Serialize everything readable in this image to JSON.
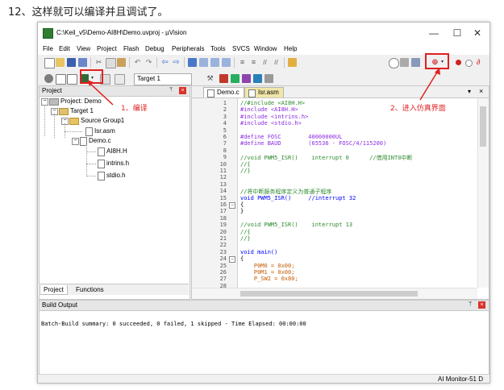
{
  "caption": "12、这样就可以编译并且调试了。",
  "window": {
    "title": "C:\\Keil_v5\\Demo-AI8H\\Demo.uvproj - µVision",
    "minimize": "—",
    "maximize": "☐",
    "close": "✕"
  },
  "menu": [
    "File",
    "Edit",
    "View",
    "Project",
    "Flash",
    "Debug",
    "Peripherals",
    "Tools",
    "SVCS",
    "Window",
    "Help"
  ],
  "toolbar2": {
    "target": "Target 1"
  },
  "project_panel": {
    "title": "Project",
    "pin": "ᛘ",
    "close": "×",
    "root": "Project: Demo",
    "target": "Target 1",
    "group": "Source Group1",
    "files": [
      "Isr.asm",
      "Demo.c"
    ],
    "includes": [
      "AI8H.H",
      "intrins.h",
      "stdio.h"
    ],
    "tabs": [
      "Project",
      "Functions"
    ]
  },
  "editor": {
    "tabs": [
      "Demo.c",
      "Isr.asm"
    ],
    "tabs_menu": "▾",
    "close": "×",
    "lines": [
      {
        "n": "1",
        "t": "//#include <AI8H.H>",
        "c": "cmt"
      },
      {
        "n": "2",
        "t": "#include <AI8H.H>",
        "c": "pp"
      },
      {
        "n": "3",
        "t": "#include <intrins.h>",
        "c": "pp"
      },
      {
        "n": "4",
        "t": "#include <stdio.h>",
        "c": "pp"
      },
      {
        "n": "5",
        "t": "",
        "c": ""
      },
      {
        "n": "6",
        "t": "#define FOSC        40000000UL",
        "c": "pp"
      },
      {
        "n": "7",
        "t": "#define BAUD        (65536 - FOSC/4/115200)",
        "c": "pp"
      },
      {
        "n": "8",
        "t": "",
        "c": ""
      },
      {
        "n": "9",
        "t": "//void PWM5_ISR()    interrupt 0      //借用INT0中断",
        "c": "cmt"
      },
      {
        "n": "10",
        "t": "//{",
        "c": "cmt"
      },
      {
        "n": "11",
        "t": "//}",
        "c": "cmt"
      },
      {
        "n": "12",
        "t": "",
        "c": ""
      },
      {
        "n": "13",
        "t": "",
        "c": ""
      },
      {
        "n": "14",
        "t": "//将中断服务程序定义为普通子程序",
        "c": "cmt"
      },
      {
        "n": "15",
        "t": "void PWM5_ISR()     //interrupt 32",
        "c": "kw"
      },
      {
        "n": "16",
        "t": "{",
        "c": ""
      },
      {
        "n": "17",
        "t": "}",
        "c": ""
      },
      {
        "n": "18",
        "t": "",
        "c": ""
      },
      {
        "n": "19",
        "t": "//void PWM5_ISR()    interrupt 13",
        "c": "cmt"
      },
      {
        "n": "20",
        "t": "//{",
        "c": "cmt"
      },
      {
        "n": "21",
        "t": "//}",
        "c": "cmt"
      },
      {
        "n": "22",
        "t": "",
        "c": ""
      },
      {
        "n": "23",
        "t": "void main()",
        "c": "kw"
      },
      {
        "n": "24",
        "t": "{",
        "c": ""
      },
      {
        "n": "25",
        "t": "    P0M0 = 0x00;",
        "c": "num"
      },
      {
        "n": "26",
        "t": "    P0M1 = 0x00;",
        "c": "num"
      },
      {
        "n": "27",
        "t": "    P_SW2 = 0x80;",
        "c": "num"
      },
      {
        "n": "28",
        "t": "",
        "c": ""
      }
    ]
  },
  "build_output": {
    "title": "Build Output",
    "pin": "ᛘ",
    "close": "×",
    "text": "Batch-Build summary: 0 succeeded, 0 failed, 1 skipped - Time Elapsed: 00:00:00"
  },
  "status": "AI Monitor-51 D",
  "annotations": {
    "compile": "1、编译",
    "debug": "2、进入仿真界面"
  },
  "colors": {
    "accent_red": "#e02020",
    "folder": "#e8c462"
  }
}
